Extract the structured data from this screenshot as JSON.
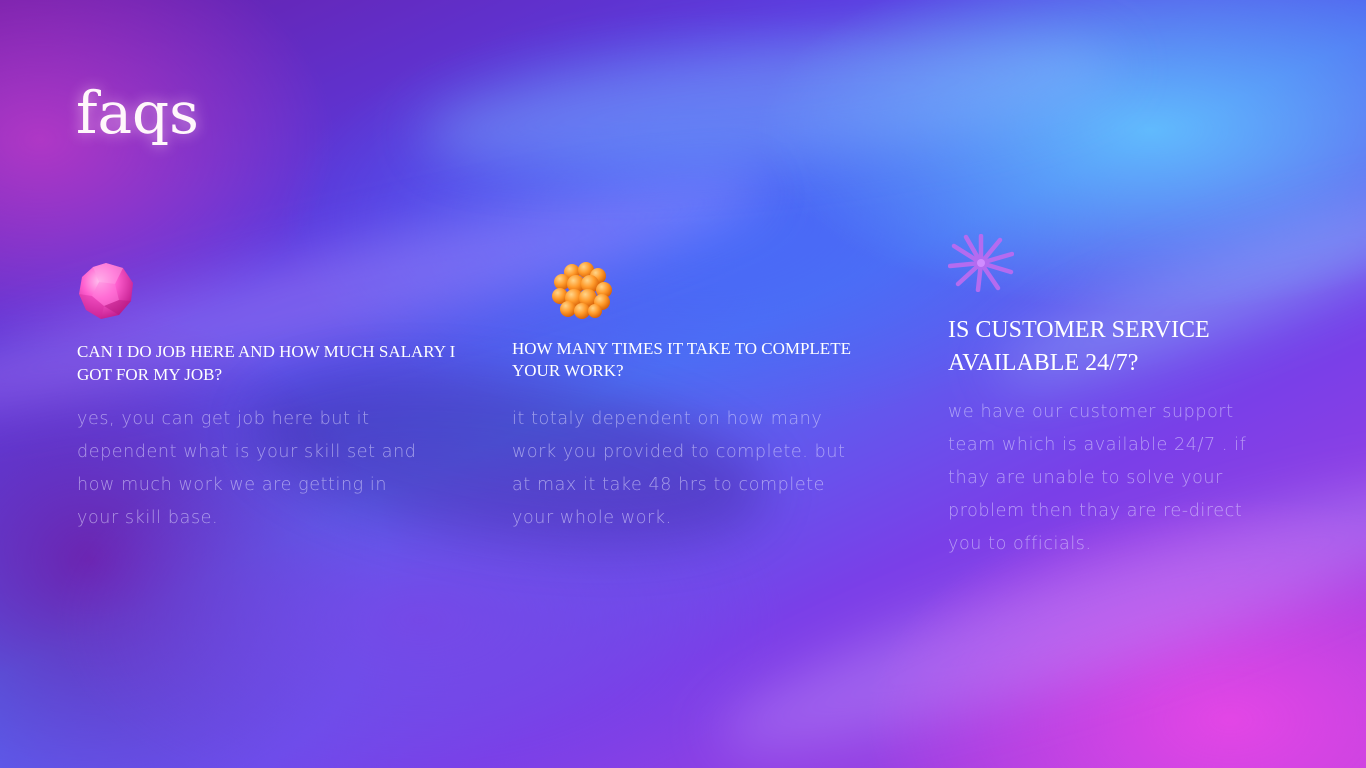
{
  "page": {
    "title": "faqs"
  },
  "faqs": [
    {
      "icon": "pink-gem-icon",
      "question": "CAN I DO JOB HERE AND HOW MUCH SALARY I GOT FOR MY JOB?",
      "answer": "yes, you can get job here but it dependent what is your skill set and how much work we are getting in your skill base."
    },
    {
      "icon": "orange-sphere-cluster-icon",
      "question": "HOW MANY TIMES IT TAKE TO COMPLETE YOUR WORK?",
      "answer": "it totaly dependent on how many work you provided to complete. but at max it take 48 hrs to complete your whole work."
    },
    {
      "icon": "purple-starburst-icon",
      "question": "IS CUSTOMER SERVICE AVAILABLE 24/7?",
      "answer": "we have our customer support team which is available 24/7 . if thay are unable to solve your problem then thay are re-direct you to officials."
    }
  ],
  "colors": {
    "pink_gem": "#ff5fcf",
    "orange_cluster": "#ff9a2a",
    "purple_starburst": "#b46bf0",
    "background_blue": "#4f6cf2",
    "background_magenta": "#e046e0"
  }
}
